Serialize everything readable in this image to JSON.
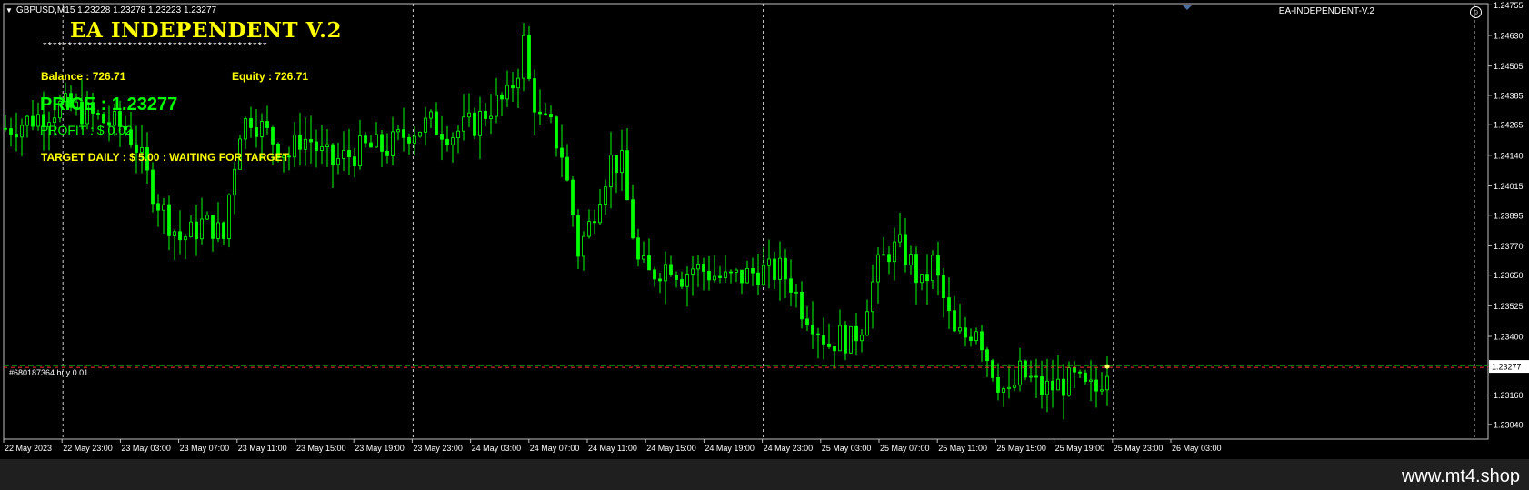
{
  "header": {
    "symbol_line": "GBPUSD,M15  1.23228 1.23278 1.23223 1.23277",
    "ea_label": "EA-INDEPENDENT-V.2"
  },
  "panel": {
    "title": "EA INDEPENDENT V.2",
    "stars": "*********************************************",
    "balance": "Balance : 726.71",
    "equity": "Equity : 726.71",
    "price": "PRICE : 1.23277",
    "profit": "PROFIT : $ 0.02",
    "target": "TARGET DAILY : $ 5.00 : WAITING FOR TARGET"
  },
  "order": {
    "label": "#680187364 buy 0.01"
  },
  "watermark": "www.mt4.shop",
  "colors": {
    "candle": "#00ff00",
    "text_yellow": "#ffff00",
    "order_line_green": "#00c000",
    "order_line_red": "#ff3030"
  },
  "chart_data": {
    "type": "candlestick",
    "symbol": "GBPUSD",
    "timeframe": "M15",
    "ylim": [
      1.2298,
      1.2476
    ],
    "y_ticks": [
      "1.24755",
      "1.24630",
      "1.24505",
      "1.24385",
      "1.24265",
      "1.24140",
      "1.24015",
      "1.23895",
      "1.23770",
      "1.23650",
      "1.23525",
      "1.23400",
      "1.23277",
      "1.23160",
      "1.23040"
    ],
    "current_price": "1.23277",
    "x_ticks": [
      "22 May 2023",
      "22 May 23:00",
      "23 May 03:00",
      "23 May 07:00",
      "23 May 11:00",
      "23 May 15:00",
      "23 May 19:00",
      "23 May 23:00",
      "24 May 03:00",
      "24 May 07:00",
      "24 May 11:00",
      "24 May 15:00",
      "24 May 19:00",
      "24 May 23:00",
      "25 May 03:00",
      "25 May 07:00",
      "25 May 11:00",
      "25 May 15:00",
      "25 May 19:00",
      "25 May 23:00",
      "26 May 03:00"
    ],
    "day_separators": [
      "22 May 23:00",
      "23 May 23:00",
      "24 May 23:00",
      "25 May 23:00"
    ],
    "price_path": [
      [
        0,
        1.2425
      ],
      [
        4,
        1.2428
      ],
      [
        8,
        1.2432
      ],
      [
        10,
        1.2434
      ],
      [
        14,
        1.2432
      ],
      [
        18,
        1.2428
      ],
      [
        22,
        1.2425
      ],
      [
        24,
        1.2418
      ],
      [
        26,
        1.2405
      ],
      [
        28,
        1.2395
      ],
      [
        30,
        1.2387
      ],
      [
        32,
        1.238
      ],
      [
        34,
        1.2382
      ],
      [
        36,
        1.2386
      ],
      [
        38,
        1.2385
      ],
      [
        40,
        1.238
      ],
      [
        41,
        1.2398
      ],
      [
        43,
        1.2425
      ],
      [
        45,
        1.243
      ],
      [
        47,
        1.2425
      ],
      [
        50,
        1.2418
      ],
      [
        52,
        1.2414
      ],
      [
        54,
        1.2421
      ],
      [
        56,
        1.242
      ],
      [
        58,
        1.2414
      ],
      [
        60,
        1.2411
      ],
      [
        63,
        1.2414
      ],
      [
        66,
        1.2417
      ],
      [
        70,
        1.2417
      ],
      [
        74,
        1.2424
      ],
      [
        78,
        1.2427
      ],
      [
        82,
        1.2423
      ],
      [
        86,
        1.2427
      ],
      [
        89,
        1.2434
      ],
      [
        92,
        1.2437
      ],
      [
        94,
        1.245
      ],
      [
        95,
        1.246
      ],
      [
        96,
        1.2444
      ],
      [
        98,
        1.2428
      ],
      [
        100,
        1.2425
      ],
      [
        102,
        1.2415
      ],
      [
        104,
        1.239
      ],
      [
        105,
        1.2375
      ],
      [
        107,
        1.2385
      ],
      [
        109,
        1.24
      ],
      [
        111,
        1.2412
      ],
      [
        113,
        1.241
      ],
      [
        114,
        1.2395
      ],
      [
        116,
        1.237
      ],
      [
        118,
        1.2365
      ],
      [
        120,
        1.2368
      ],
      [
        122,
        1.237
      ],
      [
        124,
        1.2365
      ],
      [
        126,
        1.2368
      ],
      [
        128,
        1.2367
      ],
      [
        130,
        1.2365
      ],
      [
        132,
        1.2363
      ],
      [
        136,
        1.2365
      ],
      [
        138,
        1.2367
      ],
      [
        140,
        1.2366
      ],
      [
        142,
        1.2367
      ],
      [
        144,
        1.2362
      ],
      [
        146,
        1.2352
      ],
      [
        148,
        1.2347
      ],
      [
        150,
        1.234
      ],
      [
        151,
        1.2337
      ],
      [
        153,
        1.234
      ],
      [
        155,
        1.2338
      ],
      [
        157,
        1.2345
      ],
      [
        158,
        1.2355
      ],
      [
        160,
        1.2368
      ],
      [
        162,
        1.2375
      ],
      [
        164,
        1.2376
      ],
      [
        166,
        1.237
      ],
      [
        168,
        1.236
      ],
      [
        170,
        1.237
      ],
      [
        172,
        1.2355
      ],
      [
        174,
        1.234
      ],
      [
        176,
        1.234
      ],
      [
        178,
        1.2345
      ],
      [
        180,
        1.2332
      ],
      [
        182,
        1.2322
      ],
      [
        184,
        1.2315
      ],
      [
        186,
        1.2325
      ],
      [
        188,
        1.2322
      ],
      [
        190,
        1.2318
      ],
      [
        193,
        1.232
      ],
      [
        196,
        1.2322
      ],
      [
        198,
        1.2318
      ],
      [
        200,
        1.2318
      ],
      [
        202,
        1.2328
      ]
    ]
  }
}
